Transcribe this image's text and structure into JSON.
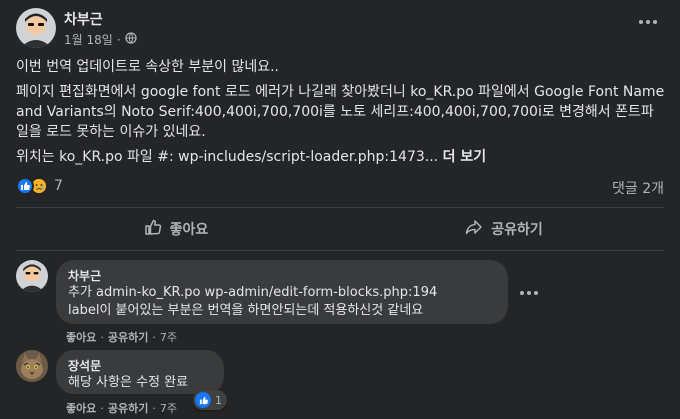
{
  "post": {
    "author": "차부근",
    "date": "1월 18일",
    "separator": "·",
    "paragraphs": [
      "이번 번역 업데이트로 속상한 부분이 많네요..",
      "페이지 편집화면에서 google font 로드 에러가 나길래 찾아봤더니 ko_KR.po 파일에서 Google Font Name and Variants의 Noto Serif:400,400i,700,700i를 노토 세리프:400,400i,700,700i로 변경해서 폰트파일을 로드 못하는 이슈가 있네요.",
      "위치는 ko_KR.po 파일 #: wp-includes/script-loader.php:1473... "
    ],
    "see_more": "더 보기",
    "reaction_count": "7",
    "comment_count": "댓글 2개",
    "like_label": "좋아요",
    "share_label": "공유하기"
  },
  "comments": [
    {
      "author": "차부근",
      "lines": [
        "추가 admin-ko_KR.po wp-admin/edit-form-blocks.php:194",
        "label이 붙어있는 부분은 번역을 하면안되는데 적용하신것 같네요"
      ],
      "like": "좋아요",
      "reply": "공유하기",
      "time": "7주"
    },
    {
      "author": "장석문",
      "lines": [
        "해당 사항은 수정 완료"
      ],
      "like": "좋아요",
      "reply": "공유하기",
      "time": "7주",
      "reaction_count": "1"
    }
  ],
  "dot": "·",
  "colors": {
    "background": "#242526",
    "bubble": "#3a3b3c",
    "text": "#e4e6eb",
    "secondary": "#b0b3b8",
    "like_blue": "#1877f2",
    "sad_yellow": "#f7b125"
  },
  "icons": [
    "globe-icon",
    "more-icon",
    "like-reaction-icon",
    "sad-reaction-icon",
    "thumbs-up-icon",
    "share-icon"
  ]
}
